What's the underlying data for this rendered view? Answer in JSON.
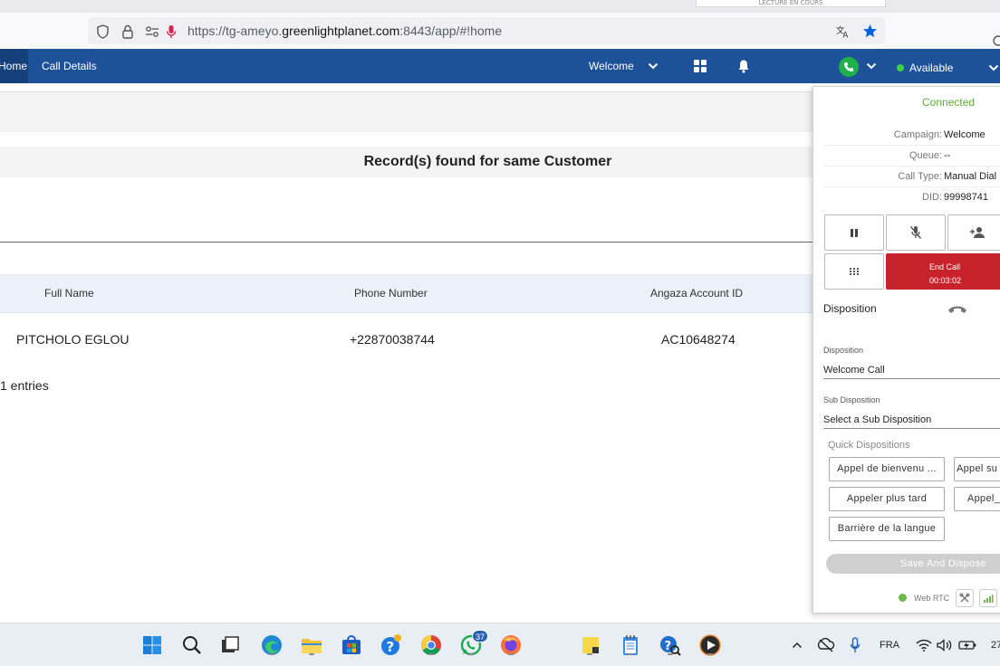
{
  "browser": {
    "background_tab_label": "LECTURE EN COURS",
    "url_prefix": "https://tg-ameyo.",
    "url_domain": "greenlightplanet.com",
    "url_suffix": ":8443/app/#!home"
  },
  "header": {
    "home_label": "Home",
    "call_details_label": "Call Details",
    "campaign_selector": "Welcome",
    "status_label": "Available",
    "brand_color": "#1d5299"
  },
  "main": {
    "section_title": "Record(s) found for same Customer",
    "columns": [
      "Full Name",
      "Phone Number",
      "Angaza Account ID"
    ],
    "rows": [
      [
        "PITCHOLO EGLOU",
        "+22870038744",
        "AC10648274"
      ]
    ],
    "footer": "1 entries"
  },
  "call_panel": {
    "status": "Connected",
    "details": [
      {
        "key": "Campaign:",
        "value": "Welcome"
      },
      {
        "key": "Queue:",
        "value": "--"
      },
      {
        "key": "Call Type:",
        "value": "Manual Dial"
      },
      {
        "key": "DID:",
        "value": "99998741"
      }
    ],
    "end_call_label": "End Call",
    "end_call_timer": "00:03:02",
    "disposition_title": "Disposition",
    "disposition_label": "Disposition",
    "disposition_value": "Welcome Call",
    "sub_disposition_label": "Sub Disposition",
    "sub_disposition_value": "Select a Sub Disposition",
    "quick_dispositions_label": "Quick Dispositions",
    "quick_dispositions": [
      "Appel de bienvenu ...",
      "Appel su",
      "Appeler plus tard",
      "Appel_",
      "Barrière de la langue"
    ],
    "save_button": "Save And Dispose",
    "webrtc_label": "Web RTC",
    "end_call_color": "#c8232b"
  },
  "taskbar": {
    "whatsapp_badge": "37",
    "language": "FRA",
    "clock": "27"
  }
}
